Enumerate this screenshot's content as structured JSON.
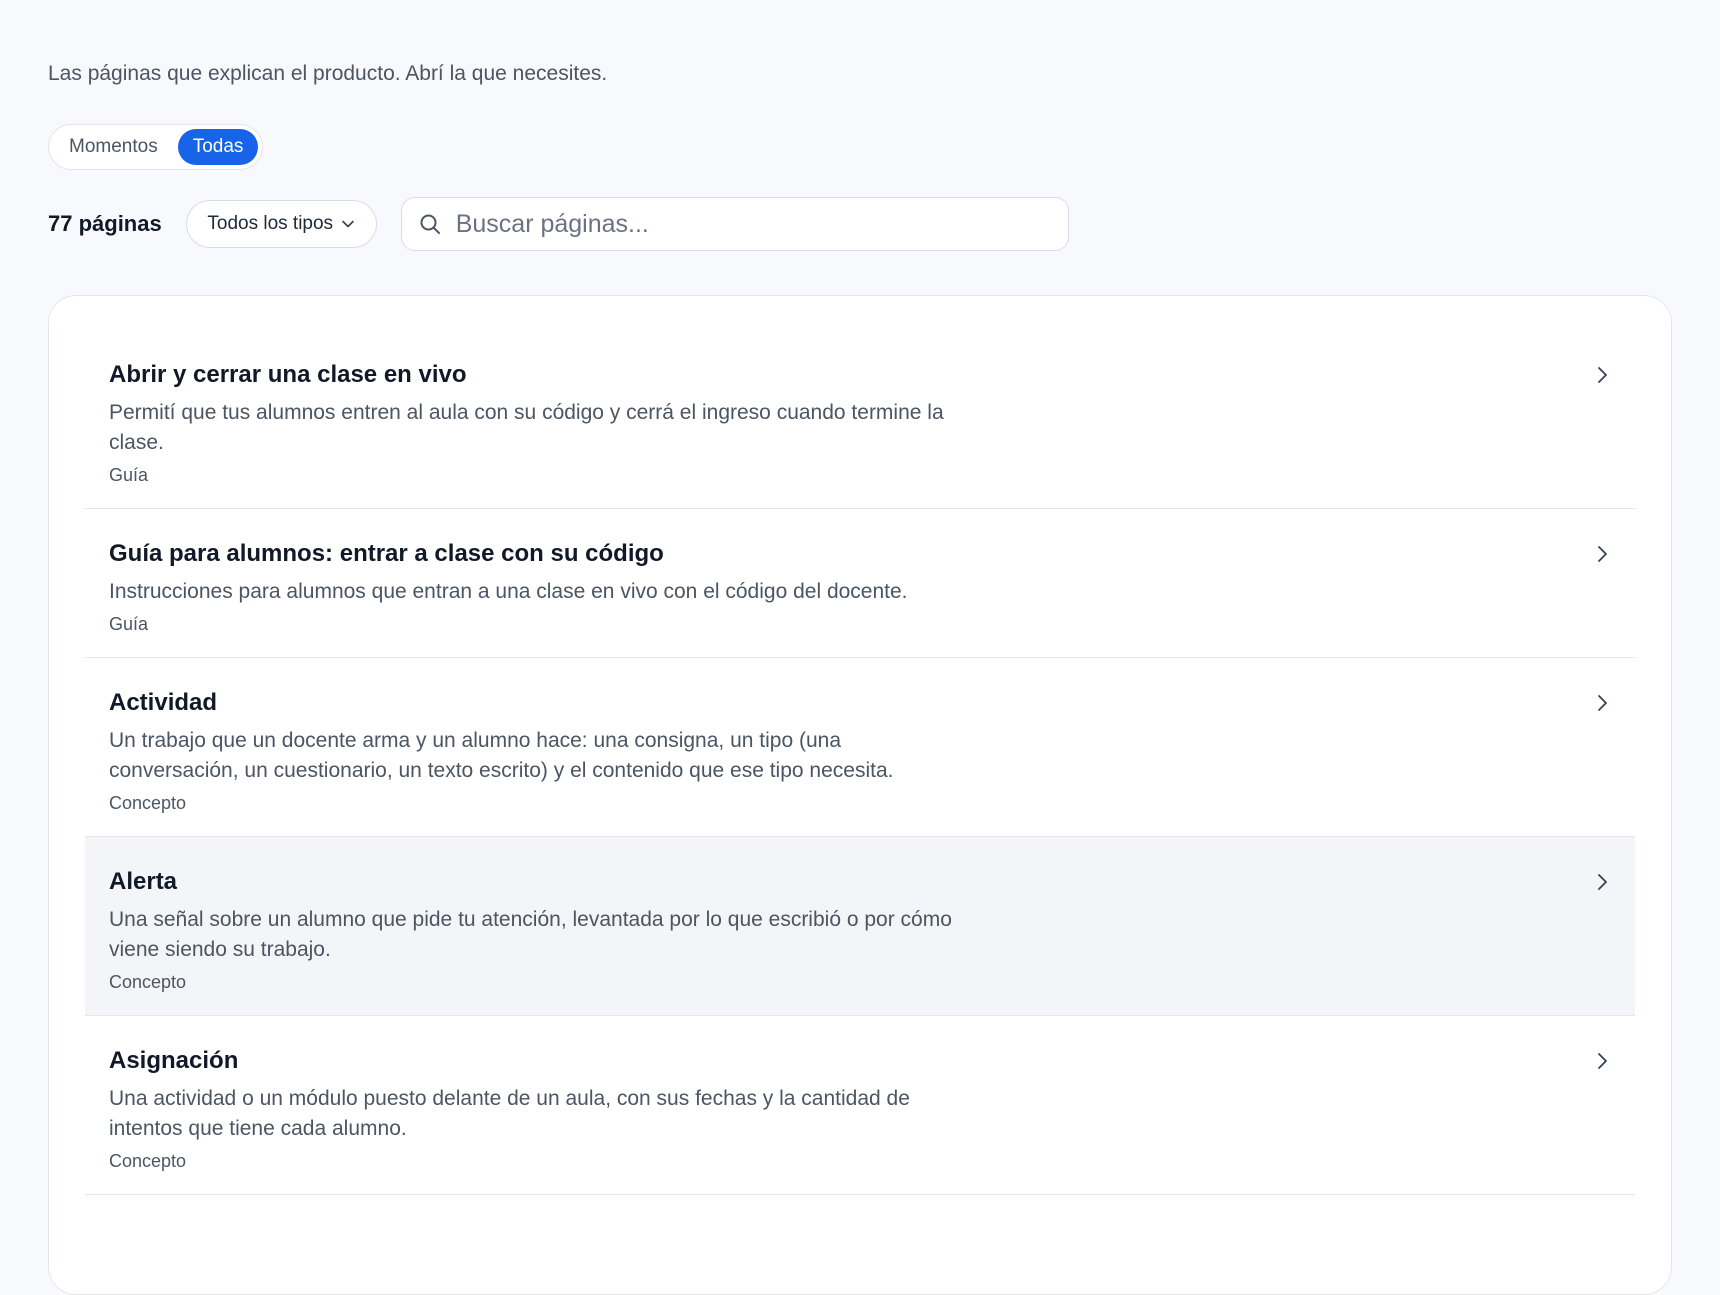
{
  "intro": "Las páginas que explican el producto. Abrí la que necesites.",
  "toggle": {
    "options": [
      "Momentos",
      "Todas"
    ],
    "selected": "Todas"
  },
  "filters": {
    "count_label": "77 páginas",
    "type_select": "Todos los tipos",
    "search_placeholder": "Buscar páginas..."
  },
  "pages": [
    {
      "title": "Abrir y cerrar una clase en vivo",
      "desc": "Permití que tus alumnos entren al aula con su código y cerrá el ingreso cuando termine la clase.",
      "type": "Guía"
    },
    {
      "title": "Guía para alumnos: entrar a clase con su código",
      "desc": "Instrucciones para alumnos que entran a una clase en vivo con el código del docente.",
      "type": "Guía"
    },
    {
      "title": "Actividad",
      "desc": "Un trabajo que un docente arma y un alumno hace: una consigna, un tipo (una conversación, un cuestionario, un texto escrito) y el contenido que ese tipo necesita.",
      "type": "Concepto"
    },
    {
      "title": "Alerta",
      "desc": "Una señal sobre un alumno que pide tu atención, levantada por lo que escribió o por cómo viene siendo su trabajo.",
      "type": "Concepto"
    },
    {
      "title": "Asignación",
      "desc": "Una actividad o un módulo puesto delante de un aula, con sus fechas y la cantidad de intentos que tiene cada alumno.",
      "type": "Concepto"
    }
  ],
  "colors": {
    "accent": "#1764e8",
    "background": "#f8f9fc",
    "card": "#ffffff",
    "hover_row": "#f4f5f8"
  },
  "icons": {
    "search": "search-icon",
    "dropdown": "chevron-down-icon",
    "row_arrow": "chevron-right-icon"
  }
}
